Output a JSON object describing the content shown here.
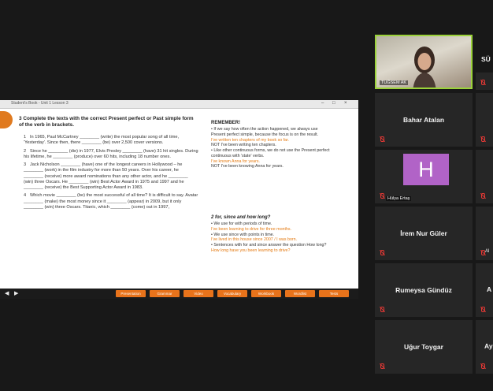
{
  "shared_screen": {
    "window_title": "Student's Book - Unit 1 Lesson 3",
    "window_controls": [
      "–",
      "□",
      "×"
    ],
    "exercise": {
      "number": "3",
      "heading": "3 Complete the texts with the correct Present perfect or Past simple form of the verb in brackets.",
      "items": [
        {
          "num": "1",
          "text": "In 1965, Paul McCartney ________ (write) the most popular song of all time, 'Yesterday'. Since then, there ________ (be) over 2,500 cover versions."
        },
        {
          "num": "2",
          "text": "Since he ________ (die) in 1977, Elvis Presley ________ (have) 31 hit singles. During his lifetime, he ________ (produce) over 60 hits, including 18 number ones."
        },
        {
          "num": "3",
          "text": "Jack Nicholson ________ (have) one of the longest careers in Hollywood – he ________ (work) in the film industry for more than 50 years. Over his career, he ________ (receive) more award nominations than any other actor, and he ________ (win) three Oscars. He ________ (win) Best Actor Award in 1975 and 1997 and he ________ (receive) the Best Supporting Actor Award in 1983."
        },
        {
          "num": "4",
          "text": "Which movie ________ (be) the most successful of all time? It is difficult to say. Avatar ________ (make) the most money since it ________ (appear) in 2009, but it only ________ (win) three Oscars. Titanic, which ________ (come) out in 1997,"
        }
      ]
    },
    "remember": {
      "title": "REMEMBER!",
      "lines": [
        {
          "text": "• If we say how often the action happened, we always use",
          "example": false
        },
        {
          "text": "Present perfect simple, because the focus is on the result.",
          "example": false
        },
        {
          "text": "I've written ten chapters of my book so far.",
          "example": true
        },
        {
          "text": "NOT I've been writing ten chapters.",
          "example": false
        },
        {
          "text": "• Like other continuous forms, we do not use the Present perfect",
          "example": false
        },
        {
          "text": "continuous with 'state' verbs.",
          "example": false
        },
        {
          "text": "I've known Anna for years.",
          "example": true
        },
        {
          "text": "NOT I've been knowing Anna for years.",
          "example": false
        }
      ]
    },
    "for_since": {
      "title": "2 for, since and how long?",
      "lines": [
        {
          "text": "• We use for with periods of time.",
          "example": false
        },
        {
          "text": "I've been learning to drive for three months.",
          "example": true
        },
        {
          "text": "• We use since with points in time.",
          "example": false
        },
        {
          "text": "I've lived in this house since 2007 / I was born.",
          "example": true
        },
        {
          "text": "• Sentences with for and since answer the question How long?",
          "example": false
        },
        {
          "text": "How long have you been learning to drive?",
          "example": true
        }
      ]
    },
    "toolbar": {
      "nav_icons": [
        "◀",
        "▶"
      ],
      "buttons": [
        "Presentation",
        "Grammar",
        "Video",
        "Vocabulary",
        "Workbook",
        "Wordlist",
        "Tests"
      ]
    }
  },
  "participants": {
    "video": {
      "tag": "TUĞSEM AK"
    },
    "right_col_first": "SÜ",
    "tiles": [
      {
        "name": "Bahar Atalan",
        "initial": "",
        "tag": "",
        "right_cut": ""
      },
      {
        "name": "",
        "initial": "H",
        "tag": "Hülya Ertaş",
        "right_cut": ""
      },
      {
        "name": "İrem Nur Güler",
        "initial": "",
        "tag": "",
        "right_cut": "Al"
      },
      {
        "name": "Rumeysa Gündüz",
        "initial": "",
        "tag": "",
        "right_cut": "A"
      },
      {
        "name": "Uğur Toygar",
        "initial": "",
        "tag": "",
        "right_cut": "Ay"
      }
    ]
  },
  "colors": {
    "accent_orange": "#e8731b",
    "speaker_border": "#9bd23a",
    "muted_mic": "#e53935",
    "avatar_purple": "#b163c7"
  }
}
